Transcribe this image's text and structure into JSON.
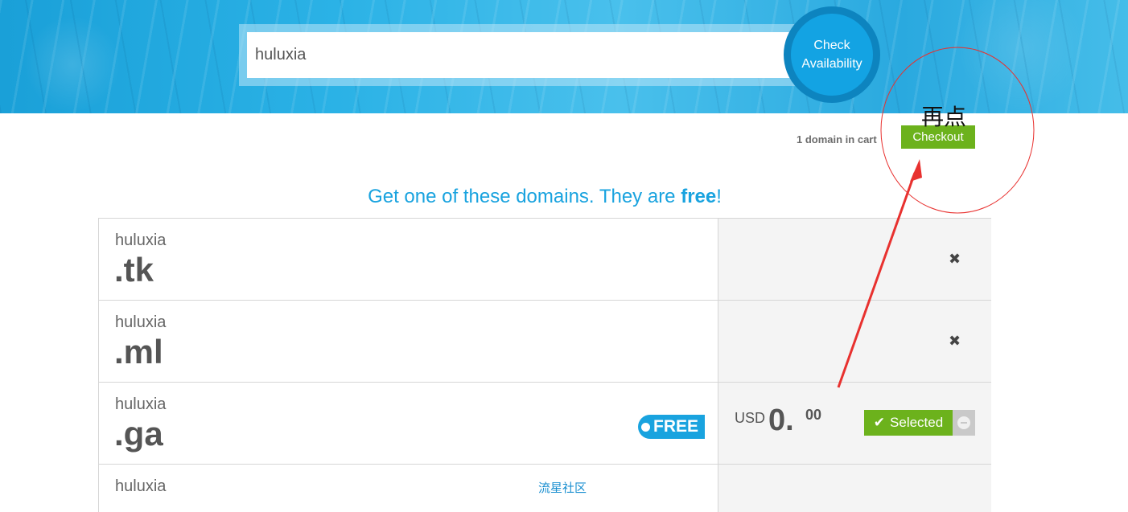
{
  "search": {
    "value": "huluxia",
    "button_line1": "Check",
    "button_line2": "Availability"
  },
  "cart": {
    "count_text": "1 domain in cart",
    "checkout_label": "Checkout"
  },
  "annotation": {
    "note": "再点",
    "color": "#e8312f"
  },
  "heading": {
    "prefix": "Get one of these domains. They are ",
    "bold": "free",
    "suffix": "!"
  },
  "domains": [
    {
      "name": "huluxia",
      "tld": ".tk",
      "remove_icon": "✖"
    },
    {
      "name": "huluxia",
      "tld": ".ml",
      "remove_icon": "✖"
    },
    {
      "name": "huluxia",
      "tld": ".ga",
      "badge": "FREE",
      "currency": "USD",
      "price_whole": "0.",
      "price_cents": "00",
      "selected_label": "Selected",
      "check_icon": "✔"
    },
    {
      "name": "huluxia"
    }
  ],
  "watermark": "流星社区",
  "colors": {
    "accent_blue": "#19a3df",
    "action_green": "#6cb21c",
    "banner_blue": "#13a3e3"
  }
}
